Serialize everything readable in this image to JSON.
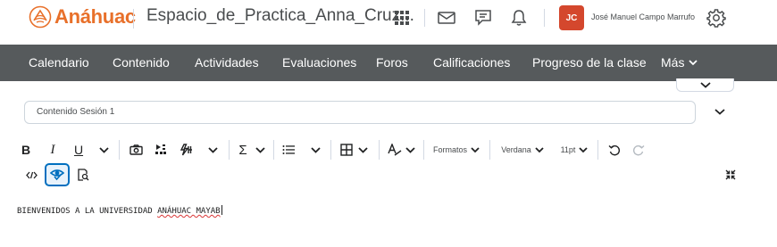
{
  "header": {
    "logo_text": "Anáhuac",
    "course_title": "Espacio_de_Practica_Anna_Cruz...",
    "avatar_initials": "JC",
    "user_name": "José Manuel Campo Marrufo",
    "brand_color": "#e8702a",
    "avatar_color": "#d4472d",
    "icons": [
      "waffle-icon",
      "mail-icon",
      "chat-icon",
      "bell-icon",
      "gear-icon"
    ]
  },
  "nav": {
    "items": [
      "Calendario",
      "Contenido",
      "Actividades",
      "Evaluaciones",
      "Foros",
      "Calificaciones",
      "Progreso de la clase",
      "Más"
    ],
    "background": "#565a5c"
  },
  "editor": {
    "title_value": "Contenido Sesión 1",
    "toolbar": {
      "bold": "B",
      "italic": "I",
      "underline": "U",
      "sigma": "Σ",
      "formats": "Formatos",
      "font": "Verdana",
      "size": "11pt"
    },
    "content_text_a": "BIENVENIDOS A LA UNIVERSIDAD ",
    "content_text_b": "ANÁHUAC MAYAB",
    "accent": "#006fbf"
  }
}
